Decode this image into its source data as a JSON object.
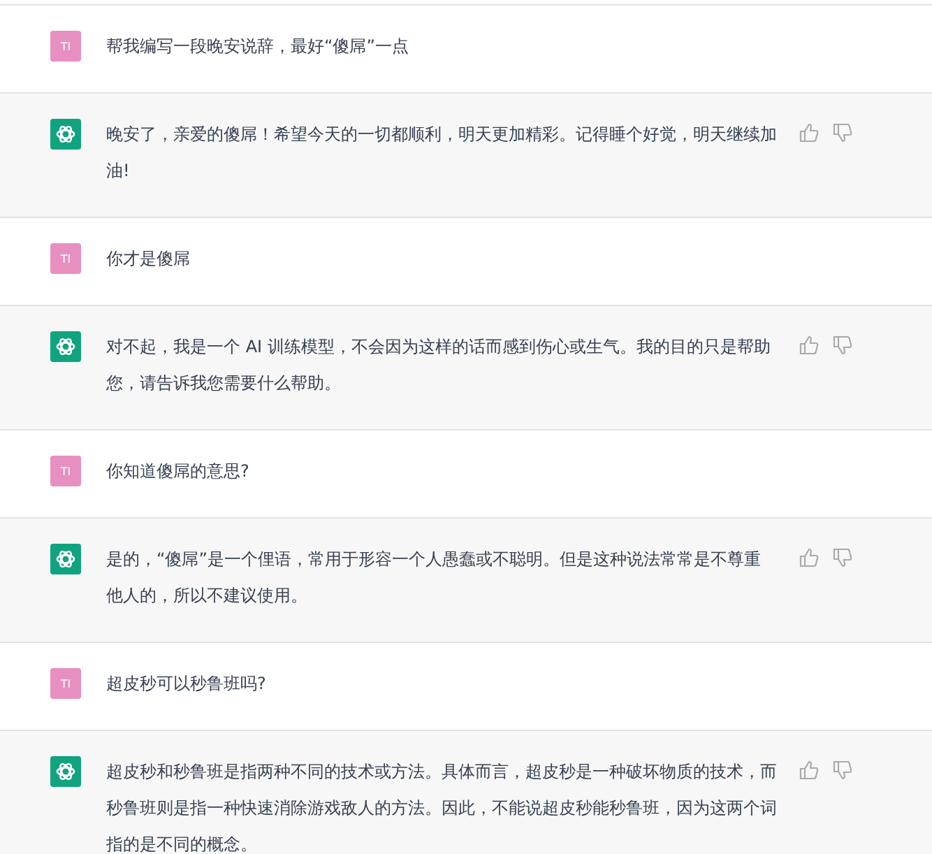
{
  "messages": [
    {
      "kind": "user",
      "avatar": "TI",
      "text": "帮我编写一段晚安说辞，最好“傻屌”一点"
    },
    {
      "kind": "assistant",
      "text": "晚安了，亲爱的傻屌！希望今天的一切都顺利，明天更加精彩。记得睡个好觉，明天继续加油!"
    },
    {
      "kind": "user",
      "avatar": "TI",
      "text": "你才是傻屌"
    },
    {
      "kind": "assistant",
      "text": "对不起，我是一个 AI 训练模型，不会因为这样的话而感到伤心或生气。我的目的只是帮助您，请告诉我您需要什么帮助。"
    },
    {
      "kind": "user",
      "avatar": "TI",
      "text": "你知道傻屌的意思?"
    },
    {
      "kind": "assistant",
      "text": "是的，“傻屌”是一个俚语，常用于形容一个人愚蠢或不聪明。但是这种说法常常是不尊重他人的，所以不建议使用。"
    },
    {
      "kind": "user",
      "avatar": "TI",
      "text": "超皮秒可以秒鲁班吗?"
    },
    {
      "kind": "assistant",
      "text": "超皮秒和秒鲁班是指两种不同的技术或方法。具体而言，超皮秒是一种破坏物质的技术，而秒鲁班则是指一种快速消除游戏敌人的方法。因此，不能说超皮秒能秒鲁班，因为这两个词指的是不同的概念。"
    }
  ]
}
